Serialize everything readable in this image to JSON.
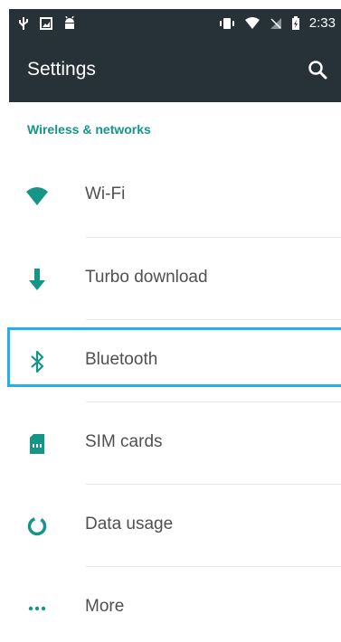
{
  "status_bar": {
    "icons_left": [
      "usb-icon",
      "image-icon",
      "android-icon"
    ],
    "icons_right": [
      "vibrate-icon",
      "wifi-icon",
      "no-signal-icon",
      "battery-charging-icon"
    ],
    "time": "2:33"
  },
  "app_bar": {
    "title": "Settings",
    "search_icon": "search-icon"
  },
  "section": {
    "title": "Wireless & networks"
  },
  "items": [
    {
      "label": "Wi-Fi",
      "icon": "wifi-icon"
    },
    {
      "label": "Turbo download",
      "icon": "download-arrow-icon"
    },
    {
      "label": "Bluetooth",
      "icon": "bluetooth-icon"
    },
    {
      "label": "SIM cards",
      "icon": "sim-card-icon"
    },
    {
      "label": "Data usage",
      "icon": "data-usage-icon"
    },
    {
      "label": "More",
      "icon": "more-dots-icon"
    }
  ],
  "colors": {
    "accent": "#159588",
    "app_bar": "#263238",
    "focus": "#22b0e6"
  }
}
